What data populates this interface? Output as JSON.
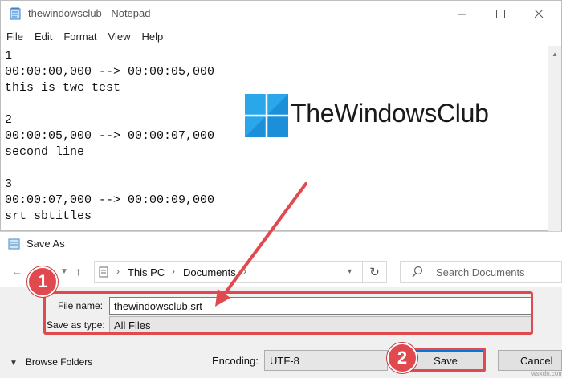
{
  "notepad": {
    "title": "thewindowsclub - Notepad",
    "menu": [
      "File",
      "Edit",
      "Format",
      "View",
      "Help"
    ],
    "lines": [
      "1",
      "00:00:00,000 --> 00:00:05,000",
      "this is twc test",
      "",
      "2",
      "00:00:05,000 --> 00:00:07,000",
      "second line",
      "",
      "3",
      "00:00:07,000 --> 00:00:09,000",
      "srt sbtitles"
    ]
  },
  "logo": {
    "text": "TheWindowsClub",
    "colors": [
      "#1e90d6",
      "#26a3e3"
    ]
  },
  "save_as": {
    "title": "Save As",
    "address": {
      "parts": [
        "This PC",
        "Documents"
      ]
    },
    "search_placeholder": "Search Documents",
    "file_name_label": "File name:",
    "file_name_value": "thewindowsclub.srt",
    "save_type_label": "Save as type:",
    "save_type_value": "All Files",
    "browse_folders": "Browse Folders",
    "encoding_label": "Encoding:",
    "encoding_value": "UTF-8",
    "save_button": "Save",
    "cancel_button": "Cancel"
  },
  "annotations": {
    "badge1": "1",
    "badge2": "2",
    "color": "#e04a4f"
  },
  "watermark": "wsxdn.com"
}
